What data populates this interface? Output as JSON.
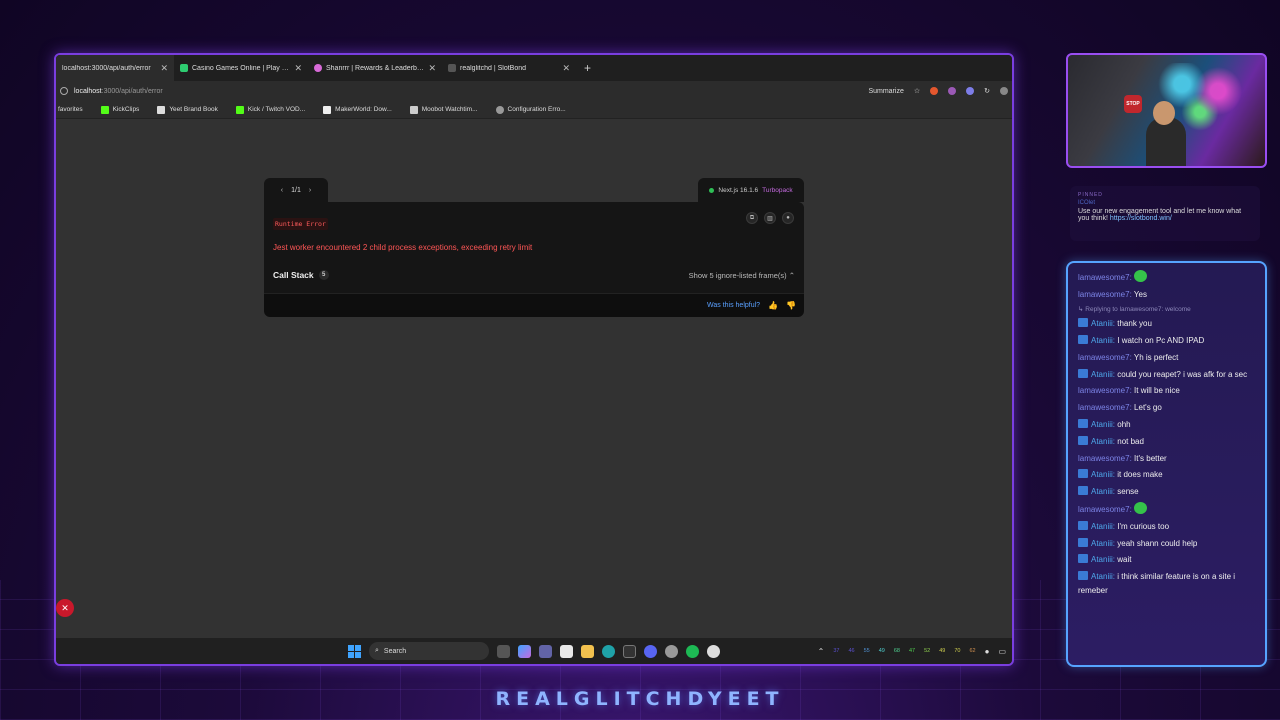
{
  "browser": {
    "tabs": [
      {
        "label": "localhost:3000/api/auth/error",
        "active": true
      },
      {
        "label": "Casino Games Online | Play Crypto",
        "active": false
      },
      {
        "label": "Shanrrr | Rewards & Leaderboards",
        "active": false
      },
      {
        "label": "realglitchd | SlotBond",
        "active": false
      }
    ],
    "address": {
      "host": "localhost",
      "path": ":3000/api/auth/error",
      "summarize": "Summarize"
    },
    "bookmarks": [
      "favorites",
      "KickClips",
      "Yeet Brand Book",
      "Kick / Twitch VOD...",
      "MakerWorld: Dow...",
      "Moobot Watchtim...",
      "Configuration Erro..."
    ]
  },
  "error_overlay": {
    "pager": {
      "prev": "‹",
      "count": "1/1",
      "next": "›"
    },
    "version": {
      "label": "Next.js 16.1.6",
      "bundler": "Turbopack"
    },
    "badge": "Runtime Error",
    "message": "Jest worker encountered 2 child process exceptions, exceeding retry limit",
    "call_stack": {
      "label": "Call Stack",
      "count": "5"
    },
    "show_ignored": "Show 5 ignore-listed frame(s) ⌃",
    "helpful": "Was this helpful?",
    "fab": "✕"
  },
  "taskbar": {
    "search": "Search",
    "tray_numbers": [
      "37",
      "46",
      "55",
      "49",
      "68",
      "47",
      "52",
      "49",
      "70",
      "62"
    ]
  },
  "pinned": {
    "header": "PINNED",
    "user": "ICOlet",
    "text": "Use our new engagement tool and let me know what you think!",
    "link": "https://slotbond.win/"
  },
  "chat": [
    {
      "user": "lamawesome7:",
      "text": "",
      "type": "u1",
      "emote": true
    },
    {
      "user": "lamawesome7:",
      "text": "Yes",
      "type": "u1"
    },
    {
      "reply": "Replying to lamawesome7: welcome"
    },
    {
      "user": "Ataniii:",
      "text": "thank you",
      "type": "u2"
    },
    {
      "user": "Ataniii:",
      "text": "I watch on Pc AND IPAD",
      "type": "u2"
    },
    {
      "user": "lamawesome7:",
      "text": "Yh is perfect",
      "type": "u1"
    },
    {
      "user": "Ataniii:",
      "text": "could you reapet? i was afk for a sec",
      "type": "u2"
    },
    {
      "user": "lamawesome7:",
      "text": "It will be nice",
      "type": "u1"
    },
    {
      "user": "lamawesome7:",
      "text": "Let's go",
      "type": "u1"
    },
    {
      "user": "Ataniii:",
      "text": "ohh",
      "type": "u2"
    },
    {
      "user": "Ataniii:",
      "text": "not bad",
      "type": "u2"
    },
    {
      "user": "lamawesome7:",
      "text": "It's better",
      "type": "u1"
    },
    {
      "user": "Ataniii:",
      "text": "it does make",
      "type": "u2"
    },
    {
      "user": "Ataniii:",
      "text": "sense",
      "type": "u2"
    },
    {
      "user": "lamawesome7:",
      "text": "",
      "type": "u1",
      "emote": true
    },
    {
      "user": "Ataniii:",
      "text": "I'm curious too",
      "type": "u2"
    },
    {
      "user": "Ataniii:",
      "text": "yeah shann could help",
      "type": "u2"
    },
    {
      "user": "Ataniii:",
      "text": "wait",
      "type": "u2"
    },
    {
      "user": "Ataniii:",
      "text": "i think similar feature is on a site i remeber",
      "type": "u2"
    }
  ],
  "brand": "REALGLITCHDYEET",
  "colors": {
    "frame": "#7a3ee0",
    "chat_border": "#56a4ff",
    "error_red": "#ff5656",
    "link_blue": "#5aa0ff"
  }
}
